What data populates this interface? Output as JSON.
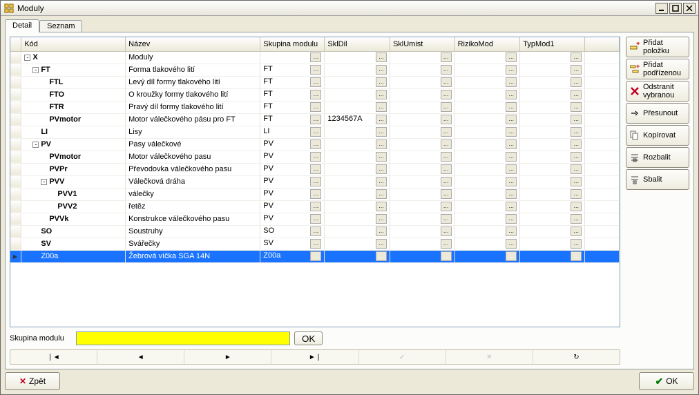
{
  "title": "Moduly",
  "tabs": {
    "detail": "Detail",
    "seznam": "Seznam"
  },
  "columns": [
    "Kód",
    "Název",
    "Skupina modulu",
    "SklDil",
    "SklUmist",
    "RizikoMod",
    "TypMod1"
  ],
  "rows": [
    {
      "depth": 0,
      "expander": "-",
      "bold": true,
      "code": "X",
      "name": "Moduly",
      "skupina": "",
      "skldil": "",
      "sklumist": "",
      "riziko": "",
      "typmod": ""
    },
    {
      "depth": 1,
      "expander": "-",
      "bold": true,
      "code": "FT",
      "name": "Forma tlakového lití",
      "skupina": "FT",
      "skldil": "",
      "sklumist": "",
      "riziko": "",
      "typmod": ""
    },
    {
      "depth": 2,
      "expander": "",
      "bold": true,
      "code": "FTL",
      "name": "Levý díl formy tlakového lití",
      "skupina": "FT",
      "skldil": "",
      "sklumist": "",
      "riziko": "",
      "typmod": ""
    },
    {
      "depth": 2,
      "expander": "",
      "bold": true,
      "code": "FTO",
      "name": "O kroužky formy tlakového lití",
      "skupina": "FT",
      "skldil": "",
      "sklumist": "",
      "riziko": "",
      "typmod": ""
    },
    {
      "depth": 2,
      "expander": "",
      "bold": true,
      "code": "FTR",
      "name": "Pravý díl formy tlakového lití",
      "skupina": "FT",
      "skldil": "",
      "sklumist": "",
      "riziko": "",
      "typmod": ""
    },
    {
      "depth": 2,
      "expander": "",
      "bold": true,
      "code": "PVmotor",
      "name": "Motor válečkového pásu pro FT",
      "skupina": "FT",
      "skldil": "1234567A",
      "sklumist": "",
      "riziko": "",
      "typmod": ""
    },
    {
      "depth": 1,
      "expander": "",
      "bold": true,
      "code": "LI",
      "name": "Lisy",
      "skupina": "LI",
      "skldil": "",
      "sklumist": "",
      "riziko": "",
      "typmod": ""
    },
    {
      "depth": 1,
      "expander": "-",
      "bold": true,
      "code": "PV",
      "name": "Pasy válečkové",
      "skupina": "PV",
      "skldil": "",
      "sklumist": "",
      "riziko": "",
      "typmod": ""
    },
    {
      "depth": 2,
      "expander": "",
      "bold": true,
      "code": "PVmotor",
      "name": "Motor válečkového pasu",
      "skupina": "PV",
      "skldil": "",
      "sklumist": "",
      "riziko": "",
      "typmod": ""
    },
    {
      "depth": 2,
      "expander": "",
      "bold": true,
      "code": "PVPr",
      "name": "Převodovka válečkového pasu",
      "skupina": "PV",
      "skldil": "",
      "sklumist": "",
      "riziko": "",
      "typmod": ""
    },
    {
      "depth": 2,
      "expander": "-",
      "bold": true,
      "code": "PVV",
      "name": "Válečková dráha",
      "skupina": "PV",
      "skldil": "",
      "sklumist": "",
      "riziko": "",
      "typmod": ""
    },
    {
      "depth": 3,
      "expander": "",
      "bold": true,
      "code": "PVV1",
      "name": "válečky",
      "skupina": "PV",
      "skldil": "",
      "sklumist": "",
      "riziko": "",
      "typmod": ""
    },
    {
      "depth": 3,
      "expander": "",
      "bold": true,
      "code": "PVV2",
      "name": "řetěz",
      "skupina": "PV",
      "skldil": "",
      "sklumist": "",
      "riziko": "",
      "typmod": ""
    },
    {
      "depth": 2,
      "expander": "",
      "bold": true,
      "code": "PVVk",
      "name": "Konstrukce válečkového pasu",
      "skupina": "PV",
      "skldil": "",
      "sklumist": "",
      "riziko": "",
      "typmod": ""
    },
    {
      "depth": 1,
      "expander": "",
      "bold": true,
      "code": "SO",
      "name": "Soustruhy",
      "skupina": "SO",
      "skldil": "",
      "sklumist": "",
      "riziko": "",
      "typmod": ""
    },
    {
      "depth": 1,
      "expander": "",
      "bold": true,
      "code": "SV",
      "name": "Svářečky",
      "skupina": "SV",
      "skldil": "",
      "sklumist": "",
      "riziko": "",
      "typmod": ""
    },
    {
      "depth": 1,
      "expander": "",
      "bold": false,
      "code": "Z00a",
      "name": "Žebrová víčka SGA 14N",
      "skupina": "Z00a",
      "skldil": "",
      "sklumist": "",
      "riziko": "",
      "typmod": "",
      "selected": true
    }
  ],
  "sidebar": {
    "add_item": "Přidat položku",
    "add_sub": "Přidat podřízenou",
    "remove_selected": "Odstranit vybranou",
    "move": "Přesunout",
    "copy": "Kopírovat",
    "expand": "Rozbalit",
    "collapse": "Sbalit"
  },
  "below": {
    "label": "Skupina modulu",
    "value": "",
    "ok": "OK"
  },
  "bottom": {
    "back": "Zpět",
    "ok": "OK"
  }
}
